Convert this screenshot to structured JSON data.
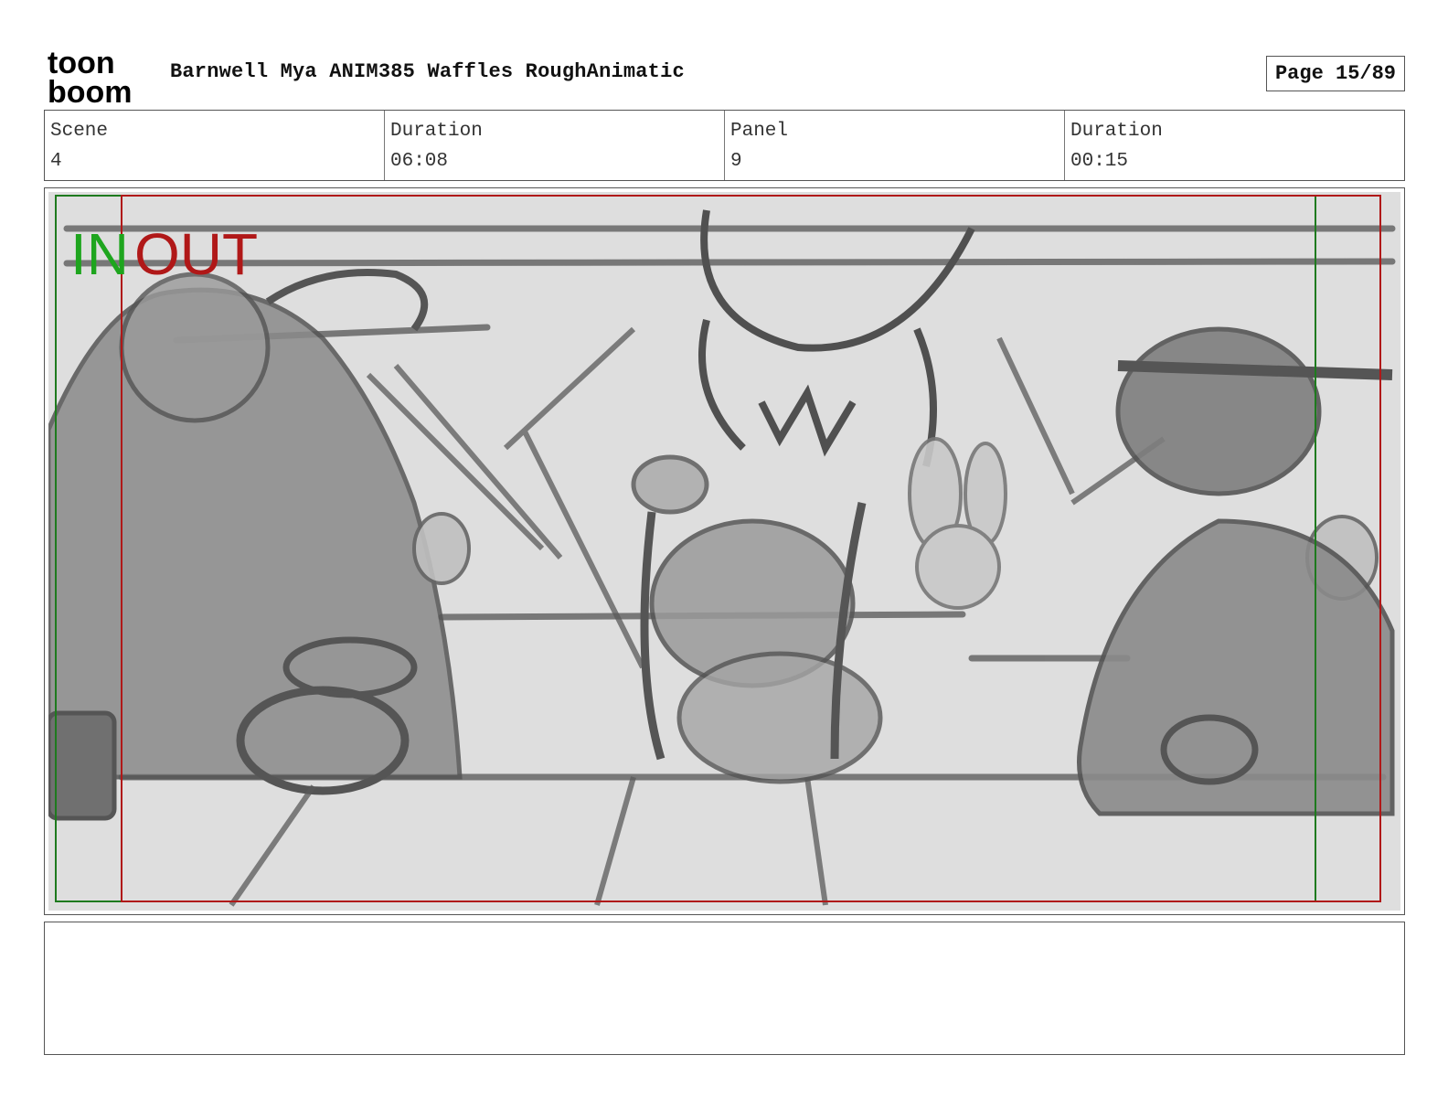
{
  "header": {
    "logo": {
      "icon": "toon-boom-logo",
      "line1": "toon",
      "line2": "boom"
    },
    "title": "Barnwell Mya ANIM385 Waffles RoughAnimatic",
    "page": "Page 15/89"
  },
  "info": [
    {
      "label": "Scene",
      "value": "4"
    },
    {
      "label": "Duration",
      "value": "06:08"
    },
    {
      "label": "Panel",
      "value": "9"
    },
    {
      "label": "Duration",
      "value": "00:15"
    }
  ],
  "panel": {
    "image": "rough-storyboard-sketch",
    "in_label": "IN",
    "out_label": "OUT",
    "colors": {
      "in": "#1ea51e",
      "out": "#b01818",
      "background": "#dedede"
    }
  },
  "notes": {
    "text": ""
  }
}
